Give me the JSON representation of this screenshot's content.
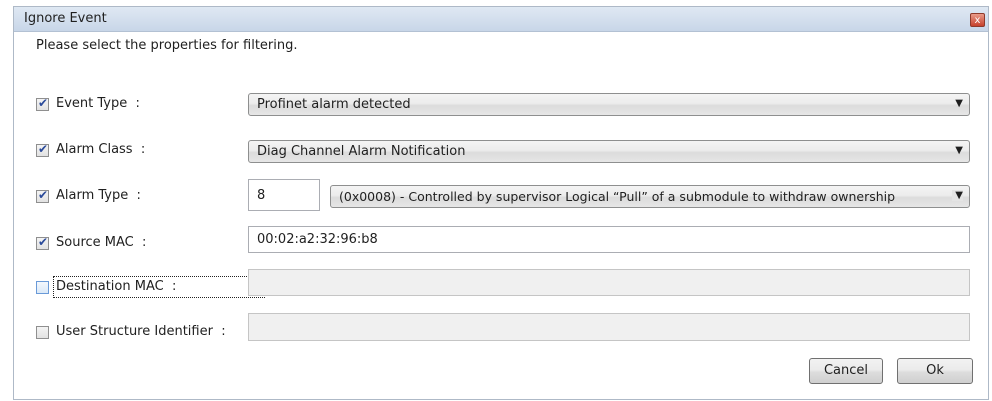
{
  "window": {
    "title": "Ignore Event",
    "close_glyph": "x"
  },
  "instructions": "Please select the properties for filtering.",
  "fields": {
    "event_type": {
      "label": "Event Type",
      "separator": ":",
      "checked": true,
      "value": "Profinet alarm detected"
    },
    "alarm_class": {
      "label": "Alarm Class",
      "separator": ":",
      "checked": true,
      "value": "Diag Channel Alarm Notification"
    },
    "alarm_type": {
      "label": "Alarm Type",
      "separator": ":",
      "checked": true,
      "code_value": "8",
      "value": "(0x0008) - Controlled by supervisor Logical “Pull” of a submodule to withdraw ownership"
    },
    "source_mac": {
      "label": "Source MAC",
      "separator": ":",
      "checked": true,
      "value": "00:02:a2:32:96:b8"
    },
    "destination_mac": {
      "label": "Destination MAC",
      "separator": ":",
      "checked": false,
      "value": ""
    },
    "user_structure_identifier": {
      "label": "User Structure Identifier",
      "separator": ":",
      "checked": false,
      "value": ""
    }
  },
  "buttons": {
    "cancel": "Cancel",
    "ok": "Ok"
  },
  "icons": {
    "checkmark": "check-icon",
    "dropdown": "chevron-down-icon",
    "close": "close-icon"
  }
}
